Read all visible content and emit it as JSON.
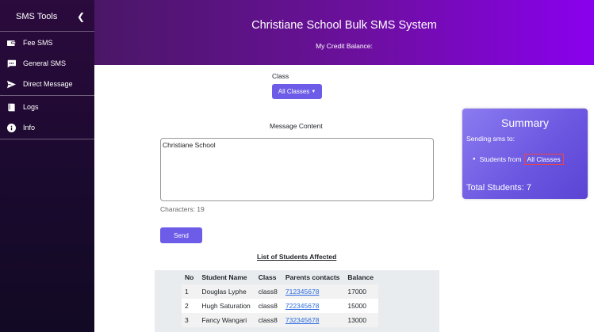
{
  "sidebar": {
    "title": "SMS Tools",
    "collapse_icon": "chevron-left-icon",
    "items": [
      {
        "label": "Fee SMS",
        "icon": "wallet-icon"
      },
      {
        "label": "General SMS",
        "icon": "message-icon"
      },
      {
        "label": "Direct Message",
        "icon": "send-icon"
      },
      {
        "label": "Logs",
        "icon": "book-icon"
      },
      {
        "label": "Info",
        "icon": "info-icon"
      }
    ]
  },
  "header": {
    "title": "Christiane School Bulk SMS System",
    "credit_label": "My Credit Balance:"
  },
  "form": {
    "class_label": "Class",
    "class_selected": "All Classes",
    "message_label": "Message Content",
    "message_value": "Christiane School",
    "characters_text": "Characters: 19",
    "send_label": "Send"
  },
  "students": {
    "title": "List of Students Affected",
    "columns": [
      "No",
      "Student Name",
      "Class",
      "Parents contacts",
      "Balance"
    ],
    "rows": [
      {
        "no": "1",
        "name": "Douglas Lyphe",
        "class": "class8",
        "contact": "712345678",
        "balance": "17000"
      },
      {
        "no": "2",
        "name": "Hugh Saturation",
        "class": "class8",
        "contact": "722345678",
        "balance": "15000"
      },
      {
        "no": "3",
        "name": "Fancy Wangari",
        "class": "class8",
        "contact": "732345678",
        "balance": "13000"
      }
    ]
  },
  "summary": {
    "title": "Summary",
    "sending_to": "Sending sms to:",
    "students_from": "Students from",
    "class_chip": "All Classes",
    "total": "Total Students: 7"
  },
  "colors": {
    "accent": "#6c5ce7",
    "header_start": "#4a1766",
    "header_end": "#8a00ee",
    "sidebar": "#1a0a2e",
    "link": "#2b6cde"
  }
}
